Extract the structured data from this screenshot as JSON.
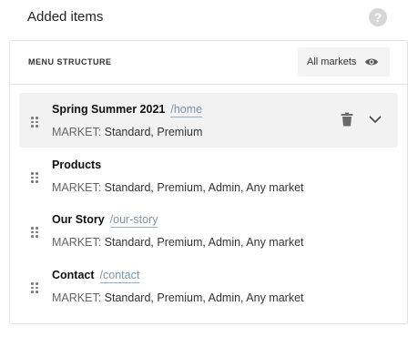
{
  "header": {
    "title": "Added items",
    "help_icon": "question-circle-icon"
  },
  "panel": {
    "section_label": "MENU STRUCTURE",
    "markets_button_label": "All markets",
    "markets_icon": "eye-icon"
  },
  "items": [
    {
      "title": "Spring Summer 2021",
      "path": "/home",
      "market_key": "MARKET:",
      "market_value": "Standard, Premium",
      "active": true
    },
    {
      "title": "Products",
      "path": "",
      "market_key": "MARKET:",
      "market_value": "Standard, Premium, Admin, Any market",
      "active": false
    },
    {
      "title": "Our Story",
      "path": "/our-story",
      "market_key": "MARKET:",
      "market_value": "Standard, Premium, Admin, Any market",
      "active": false
    },
    {
      "title": "Contact",
      "path": "/contact",
      "market_key": "MARKET:",
      "market_value": "Standard, Premium, Admin, Any market",
      "active": false
    }
  ],
  "colors": {
    "link": "#7a96ad",
    "active_row_bg": "#f2f2f2"
  }
}
